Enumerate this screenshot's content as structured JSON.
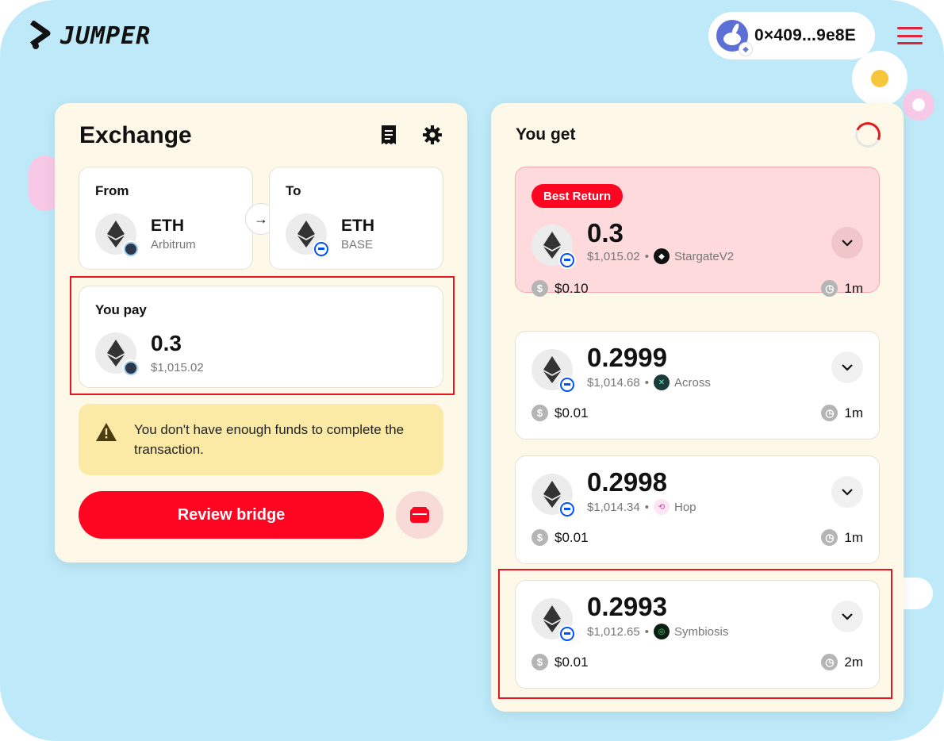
{
  "app": {
    "logo_text": "JUMPER",
    "wallet_address": "0×409...9e8E"
  },
  "exchange": {
    "title": "Exchange",
    "from": {
      "label": "From",
      "token": "ETH",
      "chain": "Arbitrum"
    },
    "to": {
      "label": "To",
      "token": "ETH",
      "chain": "BASE"
    },
    "pay": {
      "label": "You pay",
      "amount": "0.3",
      "usd": "$1,015.02"
    },
    "warning": "You don't have enough funds to complete the transaction.",
    "review_button": "Review bridge"
  },
  "you_get": {
    "title": "You get",
    "routes": [
      {
        "tag": "Best Return",
        "amount": "0.3",
        "usd": "$1,015.02",
        "bridge": "StargateV2",
        "fee": "$0.10",
        "time": "1m"
      },
      {
        "amount": "0.2999",
        "usd": "$1,014.68",
        "bridge": "Across",
        "fee": "$0.01",
        "time": "1m"
      },
      {
        "amount": "0.2998",
        "usd": "$1,014.34",
        "bridge": "Hop",
        "fee": "$0.01",
        "time": "1m"
      },
      {
        "amount": "0.2993",
        "usd": "$1,012.65",
        "bridge": "Symbiosis",
        "fee": "$0.01",
        "time": "2m"
      }
    ]
  },
  "colors": {
    "accent": "#fe0521",
    "background": "#bde9f8",
    "panel": "#fdf8e8",
    "highlight": "#e8161f"
  }
}
